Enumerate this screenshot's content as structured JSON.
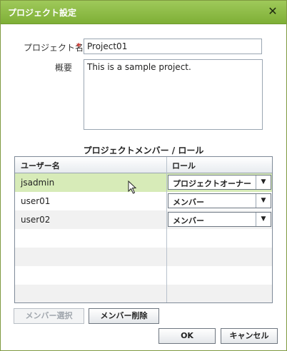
{
  "dialog": {
    "title": "プロジェクト設定"
  },
  "form": {
    "project_name_label": "プロジェクト名",
    "required_mark": "*",
    "project_name_value": "Project01",
    "summary_label": "概要",
    "summary_value": "This is a sample project."
  },
  "members": {
    "section_title": "プロジェクトメンバー / ロール",
    "columns": [
      "ユーザー名",
      "ロール"
    ],
    "rows": [
      {
        "user": "jsadmin",
        "role": "プロジェクトオーナー",
        "selected": true
      },
      {
        "user": "user01",
        "role": "メンバー",
        "selected": false
      },
      {
        "user": "user02",
        "role": "メンバー",
        "selected": false
      }
    ]
  },
  "buttons": {
    "select_members": "メンバー選択",
    "delete_members": "メンバー削除",
    "ok": "OK",
    "cancel": "キャンセル"
  },
  "icons": {
    "close": "close-icon",
    "dropdown": "chevron-down-icon",
    "cursor": "mouse-pointer-icon"
  },
  "colors": {
    "titlebar": "#8fbc47",
    "selected_row": "#d7ebb8",
    "required": "#d9342b"
  }
}
